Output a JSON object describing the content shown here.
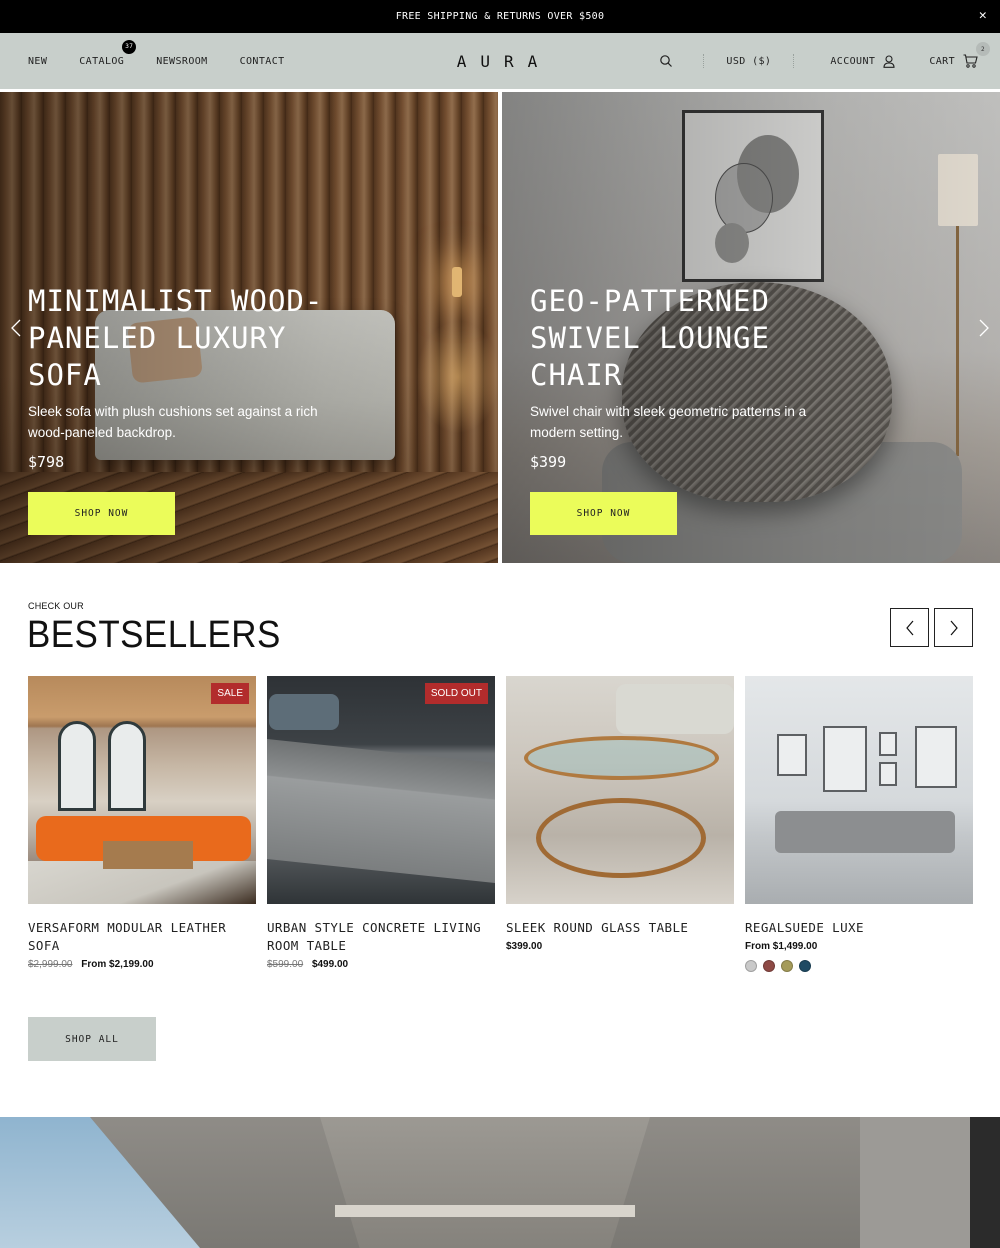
{
  "announcement": {
    "text": "FREE SHIPPING & RETURNS OVER $500",
    "close_icon": "close-icon"
  },
  "header": {
    "nav_left": [
      {
        "label": "NEW"
      },
      {
        "label": "CATALOG",
        "badge": "37"
      },
      {
        "label": "NEWSROOM"
      },
      {
        "label": "CONTACT"
      }
    ],
    "logo": "AURA",
    "search_icon": "search-icon",
    "currency": "USD ($)",
    "account_label": "ACCOUNT",
    "account_icon": "user-icon",
    "cart_label": "CART",
    "cart_icon": "cart-icon",
    "cart_count": "2"
  },
  "hero": {
    "prev_icon": "chevron-left-icon",
    "next_icon": "chevron-right-icon",
    "slides": [
      {
        "title": "MINIMALIST WOOD-PANELED LUXURY SOFA",
        "description": "Sleek sofa with plush cushions set against a rich wood-paneled backdrop.",
        "price": "$798",
        "cta": "SHOP NOW"
      },
      {
        "title": "GEO-PATTERNED SWIVEL LOUNGE CHAIR",
        "description": "Swivel chair with sleek geometric patterns in a modern setting.",
        "price": "$399",
        "cta": "SHOP NOW"
      }
    ]
  },
  "bestsellers": {
    "eyebrow": "CHECK OUR",
    "title": "BESTSELLERS",
    "prev_icon": "chevron-left-icon",
    "next_icon": "chevron-right-icon",
    "products": [
      {
        "name": "VERSAFORM MODULAR LEATHER SOFA",
        "tag": "SALE",
        "was_price": "$2,999.00",
        "price": "From $2,199.00"
      },
      {
        "name": "URBAN STYLE CONCRETE LIVING ROOM TABLE",
        "tag": "SOLD OUT",
        "was_price": "$599.00",
        "price": "$499.00"
      },
      {
        "name": "SLEEK ROUND GLASS TABLE",
        "price": "$399.00"
      },
      {
        "name": "REGALSUEDE LUXE",
        "price": "From $1,499.00",
        "swatches": [
          "#c9c9c9",
          "#8e4a45",
          "#a59b5a",
          "#1f4a63"
        ]
      }
    ],
    "shop_all": "SHOP ALL"
  },
  "colors": {
    "accent_cta": "#ebfc5a",
    "header_bg": "#c8cfcb",
    "tag_red": "#b22c2c",
    "announcement_bg": "#000000"
  }
}
